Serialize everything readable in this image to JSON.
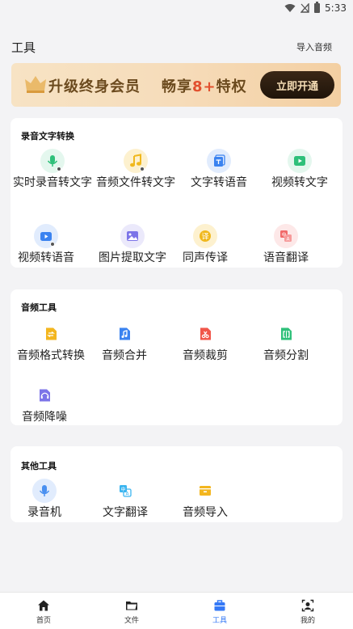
{
  "status_bar": {
    "time": "5:33",
    "icons": [
      "wifi-icon",
      "signal-icon",
      "battery-icon"
    ]
  },
  "header": {
    "title": "工具",
    "action": "导入音频"
  },
  "banner": {
    "text1": "升级终身会员",
    "text2_prefix": "畅享",
    "text2_highlight": "8+",
    "text2_suffix": "特权",
    "cta": "立即开通",
    "icon": "crown-icon"
  },
  "sections": {
    "s1": {
      "title": "录音文字转换",
      "tools": [
        {
          "label": "实时录音转文字",
          "icon": "microphone-icon",
          "color": "#2fc07a",
          "bg": "#e4f7ee"
        },
        {
          "label": "音频文件转文字",
          "icon": "music-note-icon",
          "color": "#f0b81d",
          "bg": "#fdf1cf"
        },
        {
          "label": "文字转语音",
          "icon": "text-to-speech-icon",
          "color": "#3b83f0",
          "bg": "#e1ecfd"
        },
        {
          "label": "视频转文字",
          "icon": "video-icon",
          "color": "#2fc07a",
          "bg": "#e4f7ee"
        },
        {
          "label": "视频转语音",
          "icon": "video-voice-icon",
          "color": "#3b83f0",
          "bg": "#e1ecfd"
        },
        {
          "label": "图片提取文字",
          "icon": "image-icon",
          "color": "#7c74e8",
          "bg": "#ebe9fb"
        },
        {
          "label": "同声传译",
          "icon": "interpret-icon",
          "color": "#f0b81d",
          "bg": "#fdf1cf"
        },
        {
          "label": "语音翻译",
          "icon": "translate-icon",
          "color": "#f16a6a",
          "bg": "#fde8e8"
        }
      ]
    },
    "s2": {
      "title": "音频工具",
      "tools": [
        {
          "label": "音频格式转换",
          "icon": "format-convert-icon",
          "color": "#f3b61f"
        },
        {
          "label": "音频合并",
          "icon": "audio-merge-icon",
          "color": "#3b83f0"
        },
        {
          "label": "音频裁剪",
          "icon": "audio-cut-icon",
          "color": "#f1564a"
        },
        {
          "label": "音频分割",
          "icon": "audio-split-icon",
          "color": "#2fc07a"
        },
        {
          "label": "音频降噪",
          "icon": "noise-reduction-icon",
          "color": "#7c74e8"
        }
      ]
    },
    "s3": {
      "title": "其他工具",
      "tools": [
        {
          "label": "录音机",
          "icon": "recorder-icon",
          "color": "#4a90f0",
          "bg": "#e1ecfd"
        },
        {
          "label": "文字翻译",
          "icon": "text-translate-icon",
          "color": "#3bb5f0"
        },
        {
          "label": "音频导入",
          "icon": "audio-import-icon",
          "color": "#f3b61f"
        }
      ]
    }
  },
  "tabbar": {
    "tabs": [
      {
        "label": "首页",
        "icon": "home-icon"
      },
      {
        "label": "文件",
        "icon": "folder-icon"
      },
      {
        "label": "工具",
        "icon": "toolbox-icon",
        "active": true
      },
      {
        "label": "我的",
        "icon": "profile-icon"
      }
    ]
  }
}
